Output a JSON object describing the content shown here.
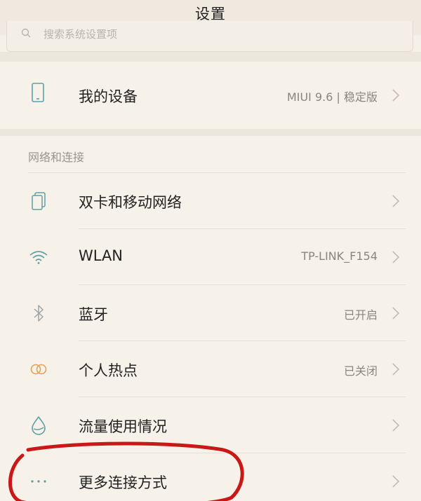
{
  "header": {
    "title": "设置",
    "search_placeholder": "搜索系统设置项"
  },
  "device_row": {
    "label": "我的设备",
    "value": "MIUI 9.6 | 稳定版",
    "icon": "phone-icon"
  },
  "network_section": {
    "header": "网络和连接",
    "items": [
      {
        "label": "双卡和移动网络",
        "value": "",
        "icon": "sim-cards-icon"
      },
      {
        "label": "WLAN",
        "value": "TP-LINK_F154",
        "icon": "wifi-icon"
      },
      {
        "label": "蓝牙",
        "value": "已开启",
        "icon": "bluetooth-icon"
      },
      {
        "label": "个人热点",
        "value": "已关闭",
        "icon": "hotspot-icon"
      },
      {
        "label": "流量使用情况",
        "value": "",
        "icon": "data-usage-icon"
      },
      {
        "label": "更多连接方式",
        "value": "",
        "icon": "more-dots-icon"
      }
    ]
  },
  "colors": {
    "background": "#f5f0e8",
    "icon_teal": "#5f9fa6",
    "icon_orange": "#e0a35f",
    "annotation_red": "#c81818"
  }
}
